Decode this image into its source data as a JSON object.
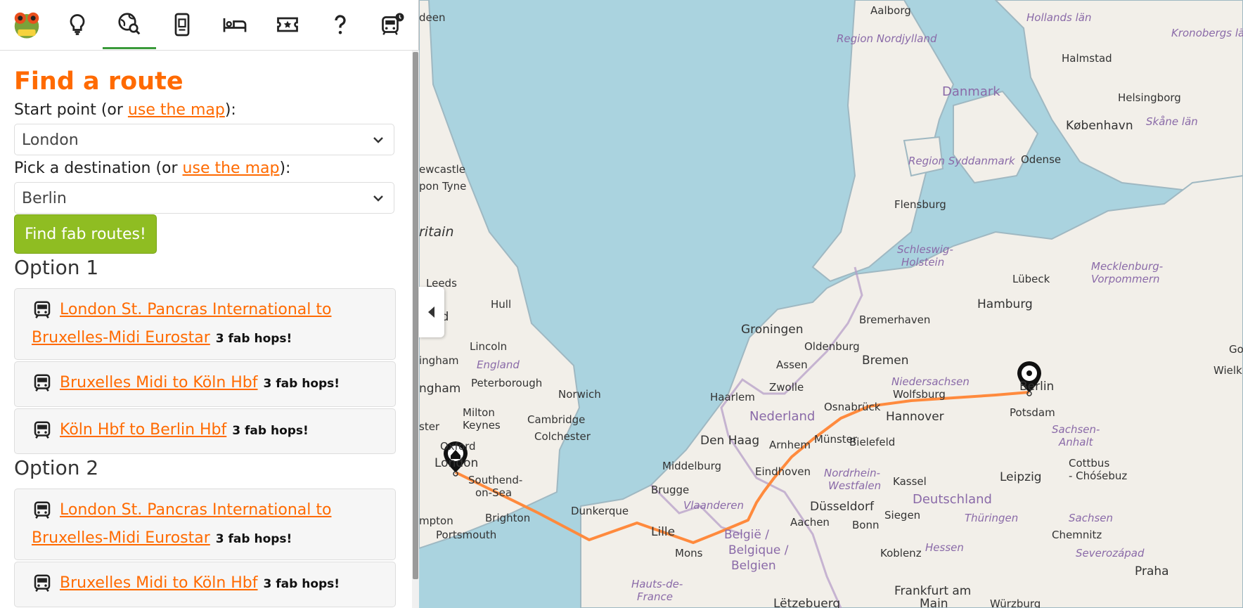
{
  "nav": {
    "items": [
      {
        "icon": "frog-logo-icon"
      },
      {
        "icon": "lightbulb-icon"
      },
      {
        "icon": "globe-search-icon",
        "active": true
      },
      {
        "icon": "ticket-icon"
      },
      {
        "icon": "bed-icon"
      },
      {
        "icon": "star-ticket-icon"
      },
      {
        "icon": "question-icon"
      },
      {
        "icon": "train-clock-icon"
      }
    ]
  },
  "form": {
    "title": "Find a route",
    "start_label_prefix": "Start point (or ",
    "start_label_link": "use the map",
    "start_label_suffix": "):",
    "start_value": "London",
    "dest_label_prefix": "Pick a destination (or ",
    "dest_label_link": "use the map",
    "dest_label_suffix": "):",
    "dest_value": "Berlin",
    "find_button": "Find fab routes!"
  },
  "options": [
    {
      "title": "Option 1",
      "legs": [
        {
          "label": "London St. Pancras International to Bruxelles-Midi Eurostar",
          "hops": "3 fab hops!"
        },
        {
          "label": "Bruxelles Midi to Köln Hbf",
          "hops": "3 fab hops!"
        },
        {
          "label": "Köln Hbf to Berlin Hbf",
          "hops": "3 fab hops!"
        }
      ]
    },
    {
      "title": "Option 2",
      "legs": [
        {
          "label": "London St. Pancras International to Bruxelles-Midi Eurostar",
          "hops": "3 fab hops!"
        },
        {
          "label": "Bruxelles Midi to Köln Hbf",
          "hops": "3 fab hops!"
        }
      ]
    }
  ],
  "map": {
    "route_color": "#ff8a3d",
    "labels": {
      "aalborg": "Aalborg",
      "hollands_lan": "Hollands län",
      "kronobergs_lan": "Kronobergs län",
      "region_nordjylland": "Region Nordjylland",
      "halmstad": "Halmstad",
      "danmark": "Danmark",
      "helsingborg": "Helsingborg",
      "skane_lan": "Skåne län",
      "kobenhavn": "København",
      "region_syddanmark": "Region Syddanmark",
      "odense": "Odense",
      "newcastle": "ewcastle",
      "upon_tyne": "pon Tyne",
      "flensburg": "Flensburg",
      "britain": "ritain",
      "schleswig": "Schleswig-",
      "holstein": "Holstein",
      "mecklenburg": "Mecklenburg-",
      "vorpommern": "Vorpommern",
      "lubeck": "Lübeck",
      "leeds": "Leeds",
      "hull": "Hull",
      "hamburg": "Hamburg",
      "sheffield": "ffield",
      "bremerhaven": "Bremerhaven",
      "groningen": "Groningen",
      "lincoln": "Lincoln",
      "oldenburg": "Oldenburg",
      "bremen": "Bremen",
      "nottingham": "ingham",
      "england": "England",
      "assen": "Assen",
      "birmingham": "ngham",
      "peterborough": "Peterborough",
      "norwich": "Norwich",
      "niedersachsen": "Niedersachsen",
      "zwolle": "Zwolle",
      "berlin": "Berlin",
      "wolfsburg": "Wolfsburg",
      "haarlem": "Haarlem",
      "nederland": "Nederland",
      "osnabruck": "Osnabrück",
      "hannover": "Hannover",
      "milton": "Milton",
      "keynes": "Keynes",
      "cambridge": "Cambridge",
      "potsdam": "Potsdam",
      "den_haag": "Den Haag",
      "arnhem": "Arnhem",
      "munster": "Münster",
      "bielefeld": "Bielefeld",
      "colchester": "Colchester",
      "sachsen_anhalt1": "Sachsen-",
      "sachsen_anhalt2": "Anhalt",
      "oxford": "Oxford",
      "london": "London",
      "middelburg": "Middelburg",
      "eindhoven": "Eindhoven",
      "nordrhein": "Nordrhein-",
      "westfalen": "Westfalen",
      "southend": "Southend-",
      "on_sea": "on-Sea",
      "kassel": "Kassel",
      "leipzig": "Leipzig",
      "cottbus": "Cottbus",
      "chosebuz": "- Chóśebuz",
      "brugge": "Brugge",
      "vlaanderen": "Vlaanderen",
      "dusseldorf": "Düsseldorf",
      "deutschland": "Deutschland",
      "dunkerque": "Dunkerque",
      "siegen": "Siegen",
      "aachen": "Aachen",
      "brighton": "Brighton",
      "thuringen": "Thüringen",
      "sachsen": "Sachsen",
      "lille": "Lille",
      "belgie": "België /",
      "belgique": "Belgique /",
      "belgien": "Belgien",
      "bonn": "Bonn",
      "portsmouth": "Portsmouth",
      "chemnitz": "Chemnitz",
      "mons": "Mons",
      "koblenz": "Koblenz",
      "hessen": "Hessen",
      "severozapad": "Severozápad",
      "praha": "Praha",
      "hauts": "Hauts-de-",
      "france": "France",
      "frankfurt": "Frankfurt am",
      "main": "Main",
      "letzebuerg": "Lëtzebuerg",
      "wurzburg": "Würzburg",
      "ston": "ster",
      "hampton": "mpton",
      "jeen": "deen",
      "gowiel": "Go",
      "wielk": "Wielk"
    }
  }
}
